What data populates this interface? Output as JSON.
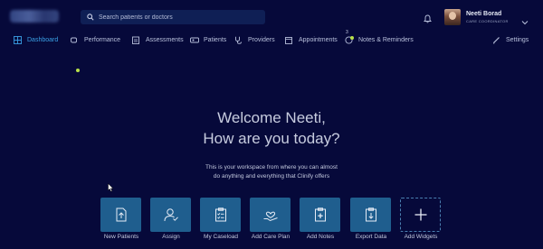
{
  "header": {
    "search_placeholder": "Search patients or doctors",
    "user_name": "Neeti Borad",
    "user_role": "CARE COORDINATOR"
  },
  "nav": {
    "items": [
      {
        "label": "Dashboard",
        "icon": "grid-icon",
        "active": true
      },
      {
        "label": "Performance",
        "icon": "performance-icon"
      },
      {
        "label": "Assessments",
        "icon": "clipboard-icon"
      },
      {
        "label": "Patients",
        "icon": "patients-icon"
      },
      {
        "label": "Providers",
        "icon": "stethoscope-icon"
      },
      {
        "label": "Appointments",
        "icon": "calendar-icon"
      },
      {
        "label": "Notes & Reminders",
        "icon": "notes-icon",
        "badge": "3"
      },
      {
        "label": "Settings",
        "icon": "pencil-icon"
      }
    ]
  },
  "welcome": {
    "line1": "Welcome Neeti,",
    "line2": "How are you today?",
    "sub1": "This is your workspace from where you can almost",
    "sub2": "do anything and everything that Clinify offers"
  },
  "actions": [
    {
      "label": "New Patients",
      "icon": "upload-file-icon"
    },
    {
      "label": "Assign",
      "icon": "assign-user-icon"
    },
    {
      "label": "My Caseload",
      "icon": "caseload-icon"
    },
    {
      "label": "Add Care Plan",
      "icon": "care-plan-icon"
    },
    {
      "label": "Add Notes",
      "icon": "add-notes-icon"
    },
    {
      "label": "Export Data",
      "icon": "export-icon"
    },
    {
      "label": "Add Widgets",
      "icon": "plus-icon"
    }
  ],
  "colors": {
    "background": "#06093a",
    "accent": "#3aa0e6",
    "tile": "#1f5e8e",
    "notification_dot": "#b8e04a"
  }
}
